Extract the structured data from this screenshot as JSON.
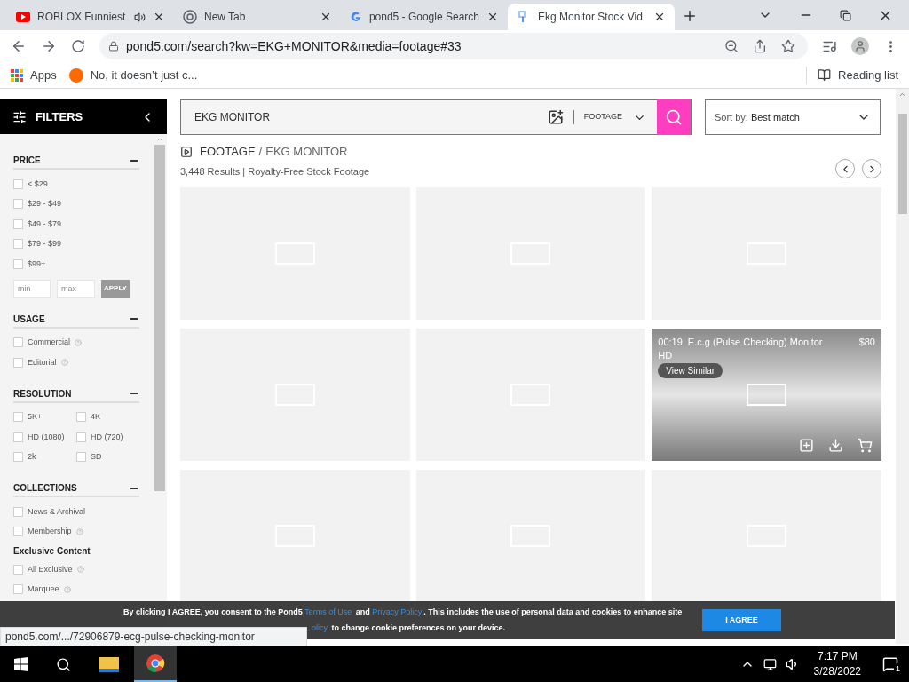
{
  "browser": {
    "tabs": [
      {
        "title": "ROBLOX Funniest",
        "audio": true,
        "selected": false
      },
      {
        "title": "New Tab",
        "audio": false,
        "selected": false
      },
      {
        "title": "pond5 - Google Search",
        "audio": false,
        "selected": false
      },
      {
        "title": "Ekg Monitor Stock Vid",
        "audio": false,
        "selected": true
      }
    ],
    "url": "pond5.com/search?kw=EKG+MONITOR&media=footage#33",
    "bookmarks": [
      {
        "label": "Apps"
      },
      {
        "label": "No, it doesn’t just c..."
      }
    ],
    "reading_list": "Reading list",
    "status_url": "pond5.com/.../72906879-ecg-pulse-checking-monitor"
  },
  "filters": {
    "title": "FILTERS",
    "sections": [
      {
        "title": "PRICE",
        "expanded": true,
        "kind": "list",
        "items": [
          {
            "kind": "checkbox",
            "label": "< $29",
            "checked": false,
            "help": false
          },
          {
            "kind": "checkbox",
            "label": "$29 - $49",
            "checked": false,
            "help": false
          },
          {
            "kind": "checkbox",
            "label": "$49 - $79",
            "checked": false,
            "help": false
          },
          {
            "kind": "checkbox",
            "label": "$79 - $99",
            "checked": false,
            "help": false
          },
          {
            "kind": "checkbox",
            "label": "$99+",
            "checked": false,
            "help": false
          }
        ],
        "range": {
          "min_placeholder": "min",
          "max_placeholder": "max",
          "apply": "APPLY"
        }
      },
      {
        "title": "USAGE",
        "expanded": true,
        "kind": "list",
        "items": [
          {
            "kind": "checkbox",
            "label": "Commercial",
            "checked": false,
            "help": true
          },
          {
            "kind": "checkbox",
            "label": "Editorial",
            "checked": false,
            "help": true
          }
        ]
      },
      {
        "title": "RESOLUTION",
        "expanded": true,
        "kind": "grid",
        "items": [
          {
            "kind": "checkbox",
            "label": "5K+",
            "checked": false,
            "help": false
          },
          {
            "kind": "checkbox",
            "label": "4K",
            "checked": false,
            "help": false
          },
          {
            "kind": "checkbox",
            "label": "HD (1080)",
            "checked": false,
            "help": false
          },
          {
            "kind": "checkbox",
            "label": "HD (720)",
            "checked": false,
            "help": false
          },
          {
            "kind": "checkbox",
            "label": "2k",
            "checked": false,
            "help": false
          },
          {
            "kind": "checkbox",
            "label": "SD",
            "checked": false,
            "help": false
          }
        ]
      },
      {
        "title": "COLLECTIONS",
        "expanded": true,
        "kind": "list",
        "items": [
          {
            "kind": "checkbox",
            "label": "News & Archival",
            "checked": false,
            "help": false
          },
          {
            "kind": "checkbox",
            "label": "Membership",
            "checked": false,
            "help": true
          },
          {
            "kind": "heading",
            "label": "Exclusive Content"
          },
          {
            "kind": "checkbox",
            "label": "All Exclusive",
            "checked": false,
            "help": true
          },
          {
            "kind": "checkbox",
            "label": "Marquee",
            "checked": false,
            "help": true
          }
        ]
      }
    ]
  },
  "search": {
    "query": "EKG MONITOR",
    "media": "FOOTAGE",
    "sort_label": "Sort by:",
    "sort_value": "Best match"
  },
  "results": {
    "breadcrumb": [
      "FOOTAGE",
      "/",
      "EKG MONITOR"
    ],
    "summary": "3,448 Results | Royalty-Free Stock Footage",
    "tiles": [
      {
        "hovered": false
      },
      {
        "hovered": false
      },
      {
        "hovered": false
      },
      {
        "hovered": false
      },
      {
        "hovered": false
      },
      {
        "hovered": true,
        "duration": "00:19",
        "title": "E.c.g (Pulse Checking) Monitor",
        "price": "$80",
        "quality": "HD",
        "button": "View Similar"
      },
      {
        "hovered": false
      },
      {
        "hovered": false
      },
      {
        "hovered": false
      }
    ]
  },
  "cookie": {
    "lines": [
      [
        {
          "kind": "text",
          "text": "By clicking I AGREE, you consent to the Pond5 "
        },
        {
          "kind": "link",
          "text": "Terms of Use"
        },
        {
          "kind": "text",
          "text": " and "
        },
        {
          "kind": "link",
          "text": "Privacy Policy"
        },
        {
          "kind": "text",
          "text": ". This includes the use of personal data and cookies to enhance site"
        }
      ],
      [
        {
          "kind": "link",
          "text": "olicy"
        },
        {
          "kind": "text",
          "text": " to change cookie preferences on your device."
        }
      ]
    ],
    "button": "I AGREE"
  },
  "taskbar": {
    "time": "7:17 PM",
    "date": "3/28/2022",
    "notifications": "1"
  }
}
